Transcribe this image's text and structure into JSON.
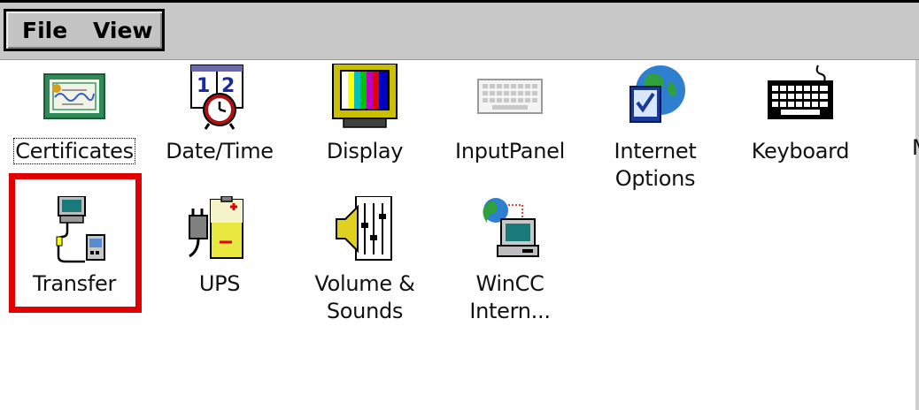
{
  "menu": {
    "file": "File",
    "view": "View"
  },
  "items": [
    {
      "label": "Certificates",
      "icon": "certificate-icon"
    },
    {
      "label": "Date/Time",
      "icon": "calendar-clock-icon"
    },
    {
      "label": "Display",
      "icon": "monitor-color-bars-icon"
    },
    {
      "label": "InputPanel",
      "icon": "input-panel-keyboard-icon"
    },
    {
      "label": "Internet",
      "label2": "Options",
      "icon": "internet-options-icon"
    },
    {
      "label": "Keyboard",
      "icon": "keyboard-icon"
    },
    {
      "label": "Transfer",
      "icon": "transfer-icon"
    },
    {
      "label": "UPS",
      "icon": "ups-battery-plug-icon"
    },
    {
      "label": "Volume &",
      "label2": "Sounds",
      "icon": "volume-speaker-icon"
    },
    {
      "label": "WinCC",
      "label2": "Intern...",
      "icon": "wincc-internet-icon"
    }
  ],
  "cutoff": "M",
  "highlight_color": "#e00000"
}
